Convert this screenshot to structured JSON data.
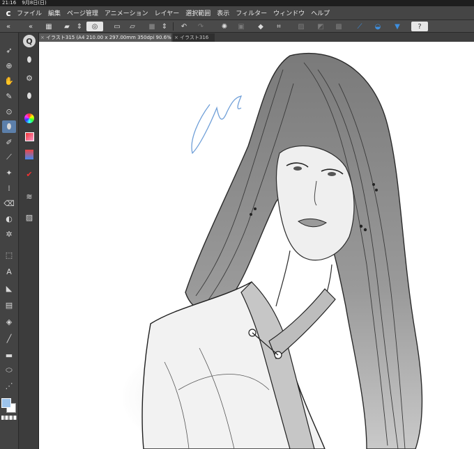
{
  "status": {
    "time": "21:16",
    "date": "9月8日(日)"
  },
  "menu": {
    "logo_icon": "clip-studio-logo-icon",
    "items": [
      "ファイル",
      "編集",
      "ページ管理",
      "アニメーション",
      "レイヤー",
      "選択範囲",
      "表示",
      "フィルター",
      "ウィンドウ",
      "ヘルプ"
    ]
  },
  "toolbar": {
    "buttons": [
      "grid-view-icon",
      "new-file-icon",
      "up-down-arrows-icon",
      "clip-studio-swirl-icon",
      "new-document-icon",
      "open-folder-icon",
      "save-square-icon",
      "up-down-arrows-icon",
      "undo-icon",
      "redo-icon",
      "spinner-icon",
      "transform-icon",
      "clear-eraser-icon",
      "crop-icon",
      "dim-icon-1",
      "dim-icon-2",
      "select-icon",
      "ruler-snap-icon",
      "curve-snap-icon",
      "pen-snap-icon",
      "help-icon"
    ]
  },
  "tabs": [
    {
      "label": "イラスト315 (A4 210.00 x 297.00mm 350dpi 90.6%)",
      "active": true
    },
    {
      "label": "イラスト316",
      "active": false
    }
  ],
  "tools": [
    "select-arrow-icon",
    "zoom-icon",
    "hand-icon",
    "pen-icon",
    "magnify-icon",
    "brush-icon",
    "pencil-icon",
    "dropper-icon",
    "airbrush-icon",
    "decoration-icon",
    "eraser-icon",
    "blend-icon",
    "snowflake-icon",
    "figure-icon",
    "text-icon",
    "balloon-icon",
    "gradient-icon",
    "fill-icon",
    "line-icon",
    "ruler-icon",
    "ellipse-icon",
    "correct-line-icon"
  ],
  "subtools": [
    "dropper-sub-icon",
    "gear-dropper-icon",
    "dual-dropper-icon",
    "color-wheel-icon",
    "color-set-icon",
    "intermediate-color-icon",
    "color-history-icon",
    "approximate-color-icon",
    "layer-stack-icon",
    "image-icon"
  ],
  "colors": {
    "main": "#9dc4ec",
    "sub": "#ffffff",
    "accent_tool": "#5c7faa",
    "sketch_signature": "#6f9fd8"
  }
}
